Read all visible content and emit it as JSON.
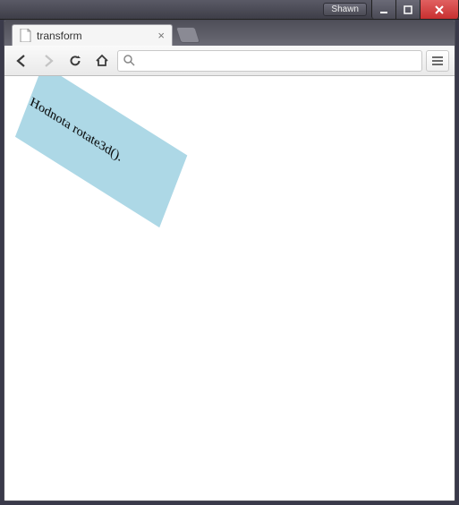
{
  "window": {
    "user_badge": "Shawn"
  },
  "tabstrip": {
    "tabs": [
      {
        "title": "transform"
      }
    ]
  },
  "toolbar": {
    "omnibox_value": "",
    "omnibox_placeholder": ""
  },
  "page": {
    "demo_text": "Hodnota rotate3d()."
  },
  "icons": {
    "file": "file-icon",
    "tab_close": "close-icon",
    "new_tab": "plus-icon",
    "back": "back-icon",
    "forward": "forward-icon",
    "reload": "reload-icon",
    "home": "home-icon",
    "search": "search-icon",
    "menu": "menu-icon",
    "win_min": "window-minimize-icon",
    "win_max": "window-maximize-icon",
    "win_close": "window-close-icon"
  },
  "colors": {
    "demo_box_bg": "#add8e6",
    "chrome_gradient_top": "#4e4e58",
    "chrome_gradient_bottom": "#6a6a75"
  }
}
